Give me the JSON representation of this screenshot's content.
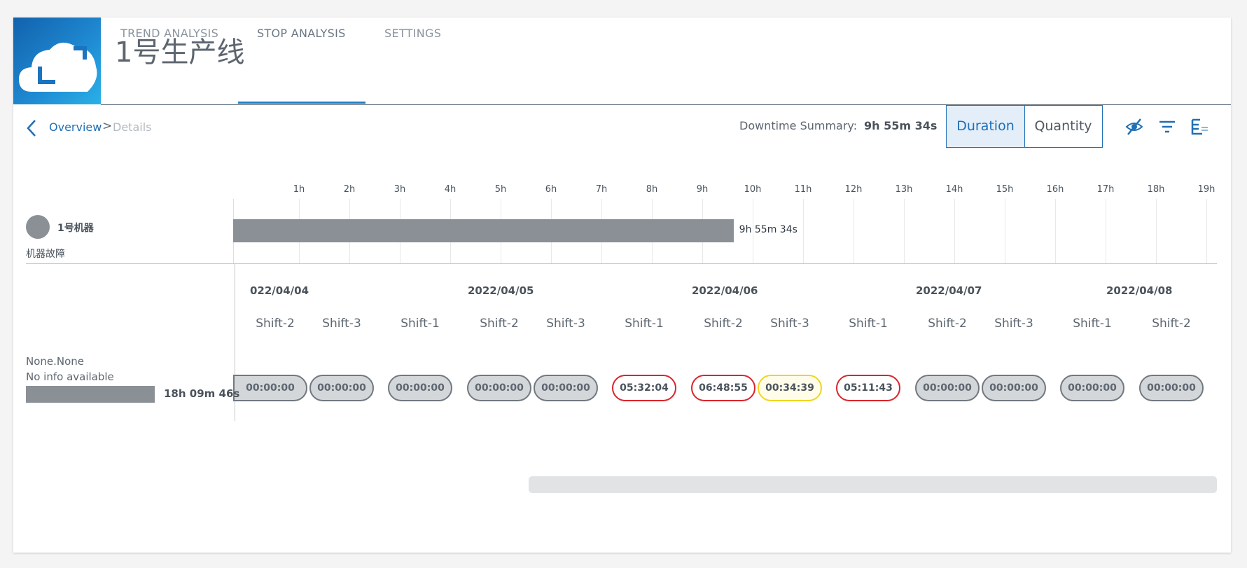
{
  "header": {
    "title": "1号生产线",
    "tabs": [
      {
        "label": "TREND ANALYSIS",
        "active": false
      },
      {
        "label": "STOP ANALYSIS",
        "active": true
      },
      {
        "label": "SETTINGS",
        "active": false
      }
    ]
  },
  "breadcrumb": {
    "overview": "Overview",
    "separator": ">",
    "details": "Details"
  },
  "toolbar": {
    "downtime_label": "Downtime Summary:",
    "downtime_value": "9h 55m 34s",
    "toggle": {
      "duration": "Duration",
      "quantity": "Quantity",
      "selected": "Duration"
    },
    "icons": [
      "visibility-off-icon",
      "filter-icon",
      "export-xls-icon"
    ]
  },
  "summary": {
    "machine_name": "1号机器",
    "fault": "机器故障",
    "bar_label": "9h 55m 34s",
    "bar_hours": 9.926,
    "axis_ticks": [
      "1h",
      "2h",
      "3h",
      "4h",
      "5h",
      "6h",
      "7h",
      "8h",
      "9h",
      "10h",
      "11h",
      "12h",
      "13h",
      "14h",
      "15h",
      "16h",
      "17h",
      "18h",
      "19h"
    ]
  },
  "timeline": {
    "row_label": "None.None",
    "row_sublabel": "No info available",
    "row_total": "18h 09m 46s",
    "dates": [
      "022/04/04",
      "2022/04/05",
      "2022/04/06",
      "2022/04/07",
      "2022/04/08"
    ],
    "shifts": [
      {
        "name": "Shift-2",
        "value": "00:00:00",
        "status": "none"
      },
      {
        "name": "Shift-3",
        "value": "00:00:00",
        "status": "none"
      },
      {
        "name": "Shift-1",
        "value": "00:00:00",
        "status": "none"
      },
      {
        "name": "Shift-2",
        "value": "00:00:00",
        "status": "none"
      },
      {
        "name": "Shift-3",
        "value": "00:00:00",
        "status": "none"
      },
      {
        "name": "Shift-1",
        "value": "05:32:04",
        "status": "red"
      },
      {
        "name": "Shift-2",
        "value": "06:48:55",
        "status": "red"
      },
      {
        "name": "Shift-3",
        "value": "00:34:39",
        "status": "yellow"
      },
      {
        "name": "Shift-1",
        "value": "05:11:43",
        "status": "red"
      },
      {
        "name": "Shift-2",
        "value": "00:00:00",
        "status": "none"
      },
      {
        "name": "Shift-3",
        "value": "00:00:00",
        "status": "none"
      },
      {
        "name": "Shift-1",
        "value": "00:00:00",
        "status": "none"
      },
      {
        "name": "Shift-2",
        "value": "00:00:00",
        "status": "none"
      }
    ]
  },
  "colors": {
    "accent": "#1f6fb5",
    "bar": "#8a9096",
    "red": "#d9252b",
    "yellow": "#f0d51f"
  }
}
